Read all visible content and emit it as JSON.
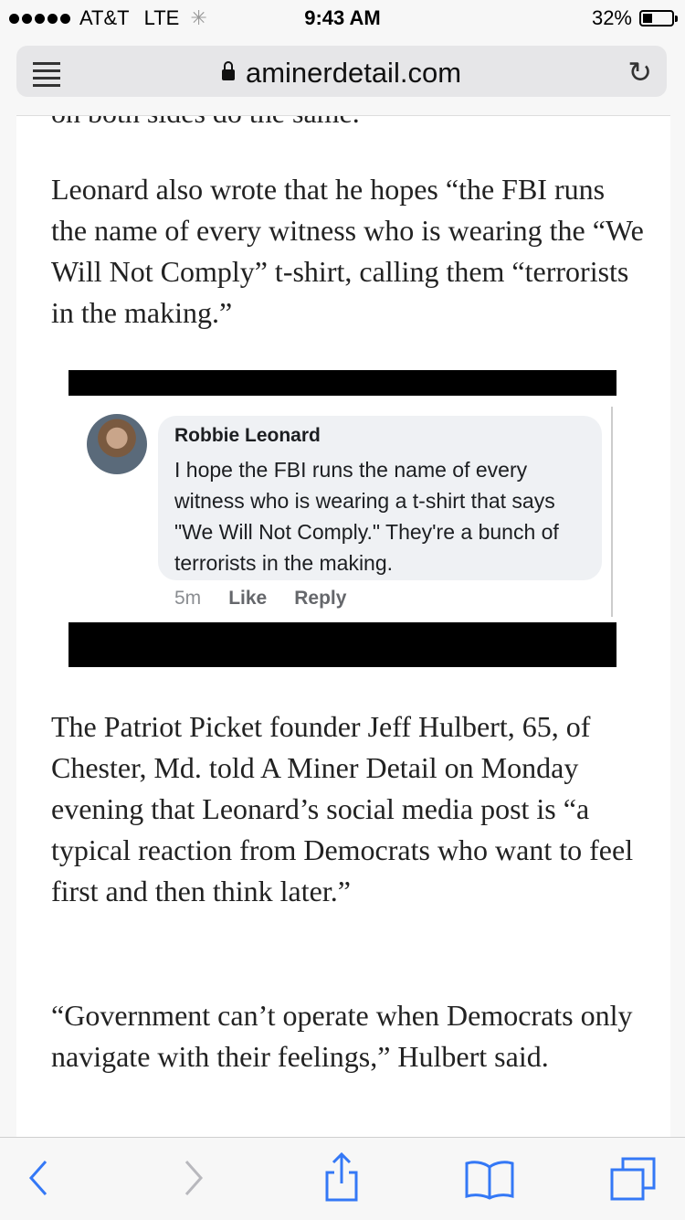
{
  "status": {
    "carrier": "AT&T",
    "network": "LTE",
    "time": "9:43 AM",
    "battery": "32%",
    "battery_level": 0.32
  },
  "browser": {
    "url": "aminerdetail.com",
    "icons": [
      "reader-icon",
      "lock-icon",
      "reload-icon",
      "back-icon",
      "forward-icon",
      "share-icon",
      "bookmarks-icon",
      "tabs-icon"
    ]
  },
  "article": {
    "cut_text": "on both sides do the same.",
    "paragraphs": [
      "Leonard also wrote that he hopes “the FBI runs the name of every witness who is wearing the “We Will Not Comply” t-shirt, calling them “terrorists in the making.”",
      "The Patriot Picket founder Jeff Hulbert, 65, of Chester, Md. told A Miner Detail on Monday evening that Leonard’s social media post is “a typical reaction from Democrats who want to feel first and then think later.”",
      "“Government can’t operate when Democrats only navigate with their feelings,” Hulbert said."
    ],
    "embed": {
      "commenter": "Robbie Leonard",
      "comment": "I hope the FBI runs the name of every witness who is wearing a t-shirt that says \"We Will Not Comply.\" They're a bunch of terrorists in the making.",
      "time_ago": "5m",
      "like_label": "Like",
      "reply_label": "Reply"
    }
  },
  "colors": {
    "accent": "#3478f6",
    "disabled": "#b8b8bd"
  }
}
